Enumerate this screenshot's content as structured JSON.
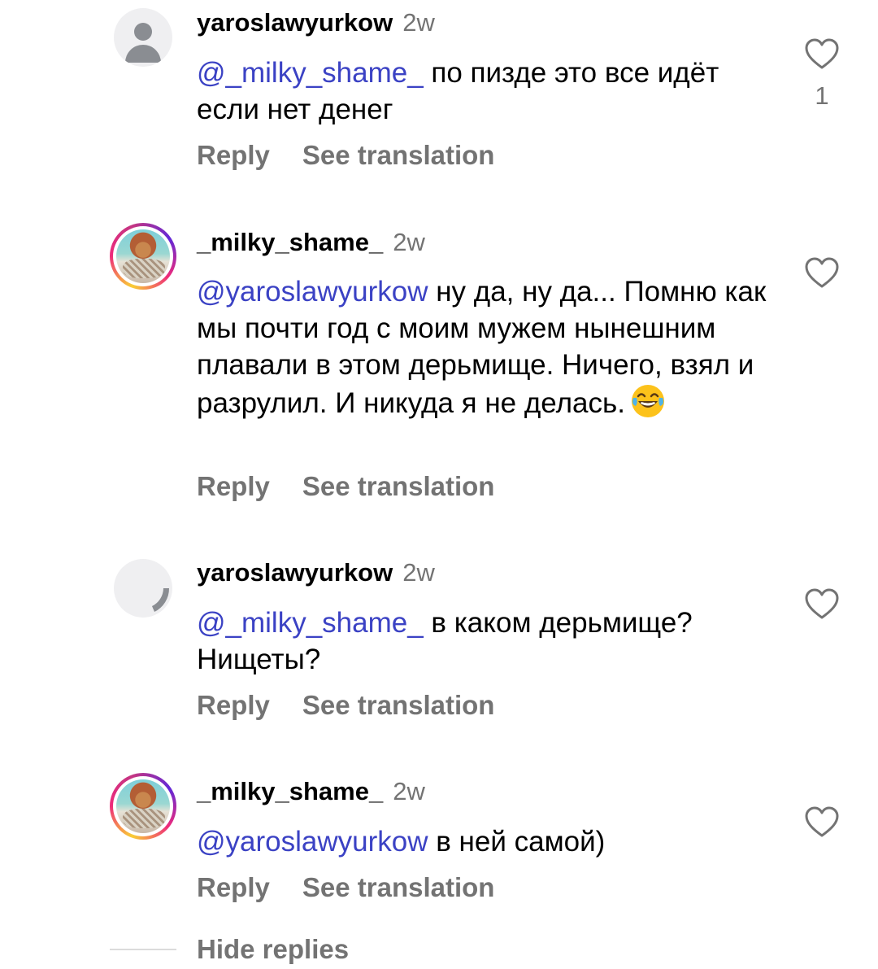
{
  "comments": [
    {
      "username": "yaroslawyurkow",
      "time": "2w",
      "mention": "@_milky_shame_",
      "text": " по пизде это все идёт если нет денег",
      "reply_label": "Reply",
      "translate_label": "See translation",
      "like_count": "1",
      "avatar": "default-avatar",
      "like_icon": "heart-outline-icon"
    },
    {
      "username": "_milky_shame_",
      "time": "2w",
      "mention": "@yaroslawyurkow",
      "text": " ну да, ну да... Помню как мы почти год с моим мужем нынешним плавали в этом дерьмище. Ничего, взял и разрулил. И никуда я не делась.",
      "emoji": "face-with-tears-of-joy",
      "reply_label": "Reply",
      "translate_label": "See translation",
      "avatar": "story-avatar",
      "like_icon": "heart-outline-icon"
    },
    {
      "username": "yaroslawyurkow",
      "time": "2w",
      "mention": "@_milky_shame_",
      "text": " в каком дерьмище? Нищеты?",
      "reply_label": "Reply",
      "translate_label": "See translation",
      "avatar": "loading-avatar",
      "like_icon": "heart-outline-icon"
    },
    {
      "username": "_milky_shame_",
      "time": "2w",
      "mention": "@yaroslawyurkow",
      "text": " в ней самой)",
      "reply_label": "Reply",
      "translate_label": "See translation",
      "avatar": "story-avatar",
      "like_icon": "heart-outline-icon"
    }
  ],
  "footer": {
    "hide_replies_label": "Hide replies"
  },
  "colors": {
    "mention": "#3b42c4",
    "secondary_text": "#737373",
    "primary_text": "#000000"
  }
}
